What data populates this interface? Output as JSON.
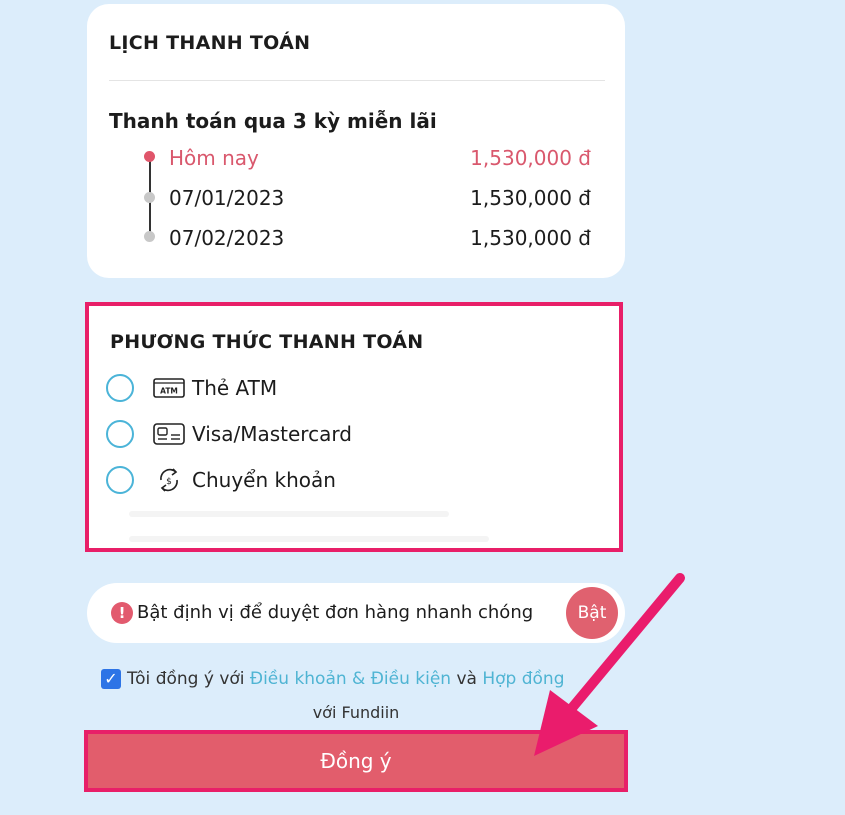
{
  "schedule": {
    "title": "LỊCH THANH TOÁN",
    "plan_title": "Thanh toán qua 3 kỳ miễn lãi",
    "installments": [
      {
        "date": "Hôm nay",
        "amount": "1,530,000 đ",
        "active": true
      },
      {
        "date": "07/01/2023",
        "amount": "1,530,000 đ",
        "active": false
      },
      {
        "date": "07/02/2023",
        "amount": "1,530,000 đ",
        "active": false
      }
    ]
  },
  "payment_method": {
    "title": "PHƯƠNG THỨC THANH TOÁN",
    "options": [
      {
        "label": "Thẻ ATM",
        "icon": "atm-card-icon"
      },
      {
        "label": "Visa/Mastercard",
        "icon": "credit-card-icon"
      },
      {
        "label": "Chuyển khoản",
        "icon": "transfer-icon"
      }
    ]
  },
  "location": {
    "alert_icon": "!",
    "text": "Bật định vị để duyệt đơn hàng nhanh chóng",
    "button_label": "Bật"
  },
  "agreement": {
    "prefix": "Tôi đồng ý với ",
    "terms_link": "Điều khoản & Điều kiện",
    "joiner": " và ",
    "contract_link": "Hợp đồng",
    "suffix": "với Fundiin",
    "checked": true
  },
  "submit_button": "Đồng ý",
  "colors": {
    "background": "#dcedfb",
    "accent": "#e0556a",
    "highlight_border": "#e81f68",
    "link": "#4fb4d3",
    "radio": "#4bb4d8"
  }
}
